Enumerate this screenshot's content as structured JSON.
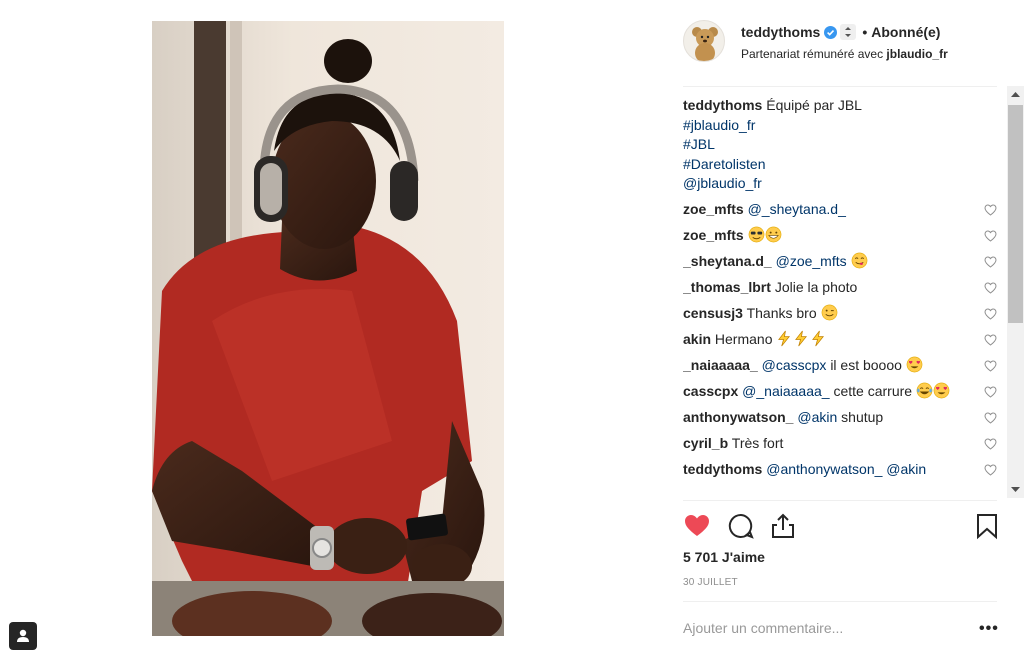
{
  "post": {
    "username": "teddythoms",
    "follow_label": "Abonné(e)",
    "partner_prefix": "Partenariat rémunéré avec",
    "partner_name": "jblaudio_fr"
  },
  "caption": {
    "user": "teddythoms",
    "text": "Équipé par JBL",
    "tags": [
      "#jblaudio_fr",
      "#JBL",
      "#Daretolisten",
      "@jblaudio_fr"
    ]
  },
  "comments": [
    {
      "user": "zoe_mfts",
      "mention": "@_sheytana.d_",
      "text": "",
      "emoji": []
    },
    {
      "user": "zoe_mfts",
      "mention": "",
      "text": "",
      "emoji": [
        "cool-face",
        "grin-face"
      ]
    },
    {
      "user": "_sheytana.d_",
      "mention": "@zoe_mfts",
      "text": "",
      "emoji": [
        "yum-face"
      ]
    },
    {
      "user": "_thomas_lbrt",
      "mention": "",
      "text": "Jolie la photo",
      "emoji": []
    },
    {
      "user": "censusj3",
      "mention": "",
      "text": "Thanks bro",
      "emoji": [
        "wink-face"
      ]
    },
    {
      "user": "akin",
      "mention": "",
      "text": "Hermano",
      "emoji": [
        "zap",
        "zap",
        "zap"
      ]
    },
    {
      "user": "_naiaaaaa_",
      "mention": "@casscpx",
      "text": "il est boooo",
      "emoji": [
        "heart-eyes"
      ]
    },
    {
      "user": "casscpx",
      "mention": "@_naiaaaaa_",
      "text": "cette carrure",
      "emoji": [
        "laugh-cry",
        "heart-eyes"
      ]
    },
    {
      "user": "anthonywatson_",
      "mention": "@akin",
      "text": "shutup",
      "emoji": []
    },
    {
      "user": "cyril_b",
      "mention": "",
      "text": "Très fort",
      "emoji": []
    },
    {
      "user": "teddythoms",
      "mention": "@anthonywatson_ @akin",
      "text": "",
      "emoji": []
    }
  ],
  "likes_text": "5 701 J'aime",
  "date_text": "30 JUILLET",
  "add_comment_placeholder": "Ajouter un commentaire...",
  "more_label": "•••",
  "colors": {
    "like_red": "#ed4956",
    "link_blue": "#003569",
    "verified_blue": "#3897f0",
    "muted": "#8e8e8e"
  }
}
